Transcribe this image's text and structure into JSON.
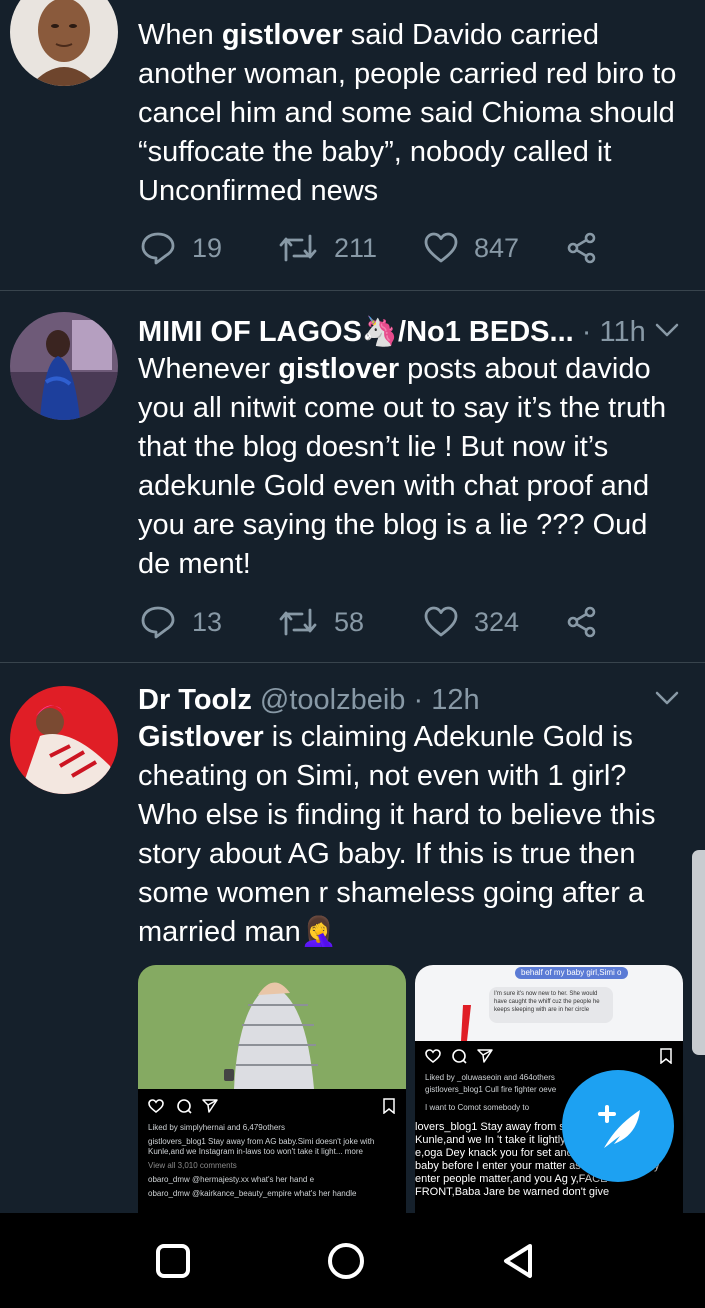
{
  "tweets": [
    {
      "name": "",
      "handle": "",
      "time": "",
      "text_parts": [
        "When ",
        "gistlover",
        " said Davido carried another woman, people carried red biro to cancel him and some said Chioma should “suffocate the baby”, nobody called it Unconfirmed news"
      ],
      "replies": "19",
      "retweets": "211",
      "likes": "847"
    },
    {
      "name": "MIMI OF LAGOS🦄/No1 BEDS...",
      "handle": "",
      "time": "· 11h",
      "text_parts": [
        "Whenever ",
        "gistlover",
        " posts about davido you all nitwit come out to say it’s the truth that the blog doesn’t lie ! But now it’s adekunle Gold even with chat proof and you are saying the blog is a lie ??? Oud de ment!"
      ],
      "replies": "13",
      "retweets": "58",
      "likes": "324"
    },
    {
      "name": "Dr Toolz",
      "handle": "@toolzbeib",
      "time": "· 12h",
      "text_parts": [
        "Gistlover",
        " is claiming Adekunle Gold is cheating on Simi, not even with 1 girl? Who else is finding it hard to believe this story about AG baby. If this is true then some women r shameless going after a married man🤦‍♀️"
      ]
    }
  ],
  "media": {
    "left": {
      "likes_line": "Liked by simplyhernai and 6,479others",
      "caption": "gistlovers_blog1 Stay away from AG baby.Simi doesn't joke with Kunle,and we Instagram in-laws too won't take it light... more",
      "view_all": "View all 3,010 comments",
      "c1": "obaro_dmw @hermajesty.xx what's her hand e",
      "c2": "obaro_dmw @kairkance_beauty_empire what's her handle"
    },
    "right": {
      "chat_top": "behalf of my baby girl,Simi o",
      "chat_bubble": "I'm sure it's now new to her. She would have caught the whiff cuz the people he keeps sleeping with are in her circle",
      "likes_line": "Liked by _oluwaseoin and 464others",
      "comment1": "gistlovers_blog1 Cull fire fighter oeve",
      "comment2": "I want to Comot somebody to",
      "caption": "lovers_blog1 Stay away from sn't joke with Kunle,and we In 't take it lightly with you,while s e,oga Dey knack you for set and y ried,avoid Ag baby before I enter your matter as mmmmyyy Dey enter people matter,and you Ag y,FACE FRONT,Baba Jare be warned don't give"
    }
  },
  "colors": {
    "background": "#15202b",
    "accent": "#1da1f2",
    "muted": "#8899a6",
    "divider": "#38444d"
  }
}
